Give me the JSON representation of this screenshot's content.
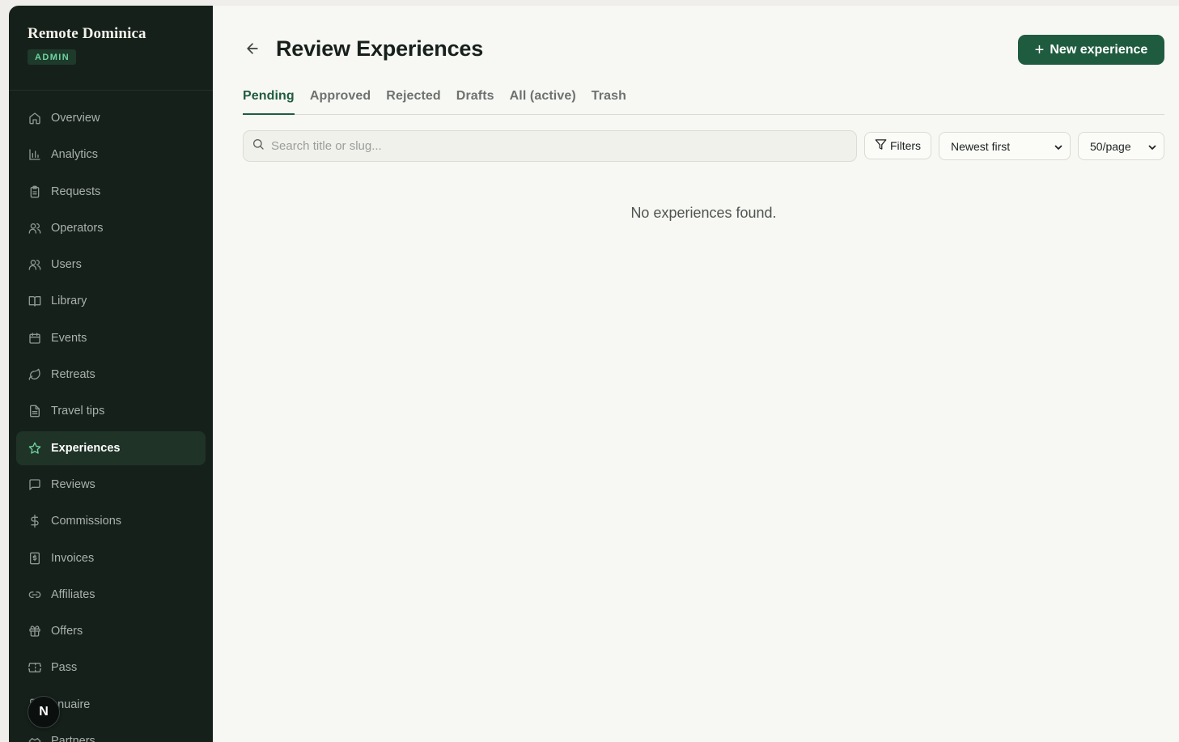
{
  "brand": {
    "name": "Remote Dominica",
    "badge": "ADMIN"
  },
  "sidebar": {
    "items": [
      {
        "label": "Overview",
        "icon": "home-icon"
      },
      {
        "label": "Analytics",
        "icon": "bar-chart-icon"
      },
      {
        "label": "Requests",
        "icon": "clipboard-icon"
      },
      {
        "label": "Operators",
        "icon": "users-icon"
      },
      {
        "label": "Users",
        "icon": "users-icon"
      },
      {
        "label": "Library",
        "icon": "book-open-icon"
      },
      {
        "label": "Events",
        "icon": "calendar-icon"
      },
      {
        "label": "Retreats",
        "icon": "leaf-icon"
      },
      {
        "label": "Travel tips",
        "icon": "file-text-icon"
      },
      {
        "label": "Experiences",
        "icon": "star-icon",
        "active": true
      },
      {
        "label": "Reviews",
        "icon": "message-square-icon"
      },
      {
        "label": "Commissions",
        "icon": "dollar-sign-icon"
      },
      {
        "label": "Invoices",
        "icon": "receipt-icon"
      },
      {
        "label": "Affiliates",
        "icon": "link-icon"
      },
      {
        "label": "Offers",
        "icon": "gift-icon"
      },
      {
        "label": "Pass",
        "icon": "ticket-icon"
      },
      {
        "label": "nnuaire",
        "icon": "book-icon"
      },
      {
        "label": "Partners",
        "icon": "handshake-icon"
      }
    ],
    "avatar_initial": "N"
  },
  "header": {
    "title": "Review Experiences",
    "back_icon": "arrow-left-icon",
    "new_button_label": "New experience"
  },
  "tabs": [
    {
      "label": "Pending",
      "active": true
    },
    {
      "label": "Approved"
    },
    {
      "label": "Rejected"
    },
    {
      "label": "Drafts"
    },
    {
      "label": "All (active)"
    },
    {
      "label": "Trash"
    }
  ],
  "toolbar": {
    "search_placeholder": "Search title or slug...",
    "search_value": "",
    "filters_label": "Filters",
    "sort_value": "Newest first",
    "page_size_value": "50/page"
  },
  "empty_state": "No experiences found.",
  "colors": {
    "sidebar_bg": "#16201b",
    "accent": "#1f5c3f",
    "accent_light": "#6fd3a0",
    "page_bg": "#f7f7f3"
  }
}
